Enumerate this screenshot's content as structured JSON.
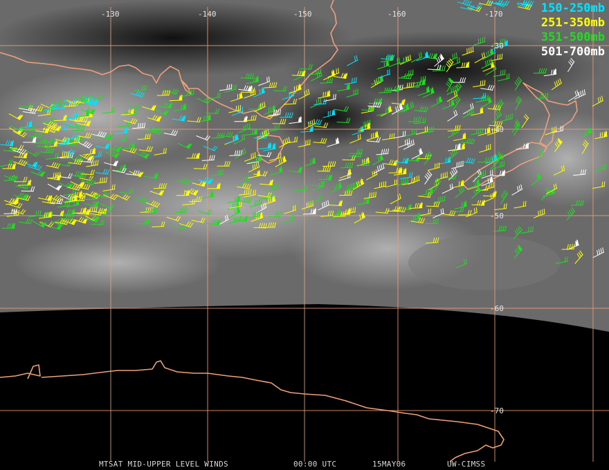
{
  "map": {
    "longitude_labels": [
      "-130",
      "-140",
      "-150",
      "-160",
      "-170"
    ],
    "latitude_labels": [
      "-30",
      "-40",
      "-50",
      "-60",
      "-70"
    ]
  },
  "legend": [
    {
      "label": "150-250mb",
      "color": "#00e5ff"
    },
    {
      "label": "251-350mb",
      "color": "#ffff00"
    },
    {
      "label": "351-500mb",
      "color": "#22dd22"
    },
    {
      "label": "501-700mb",
      "color": "#ffffff"
    }
  ],
  "footer": {
    "product": "MTSAT MID-UPPER LEVEL WINDS",
    "time": "00:00 UTC",
    "date": "15MAY06",
    "source": "UW-CIMSS"
  },
  "colors": {
    "graticule": "#f0a07a",
    "coastline": "#f0a07a",
    "space": "#000000"
  }
}
